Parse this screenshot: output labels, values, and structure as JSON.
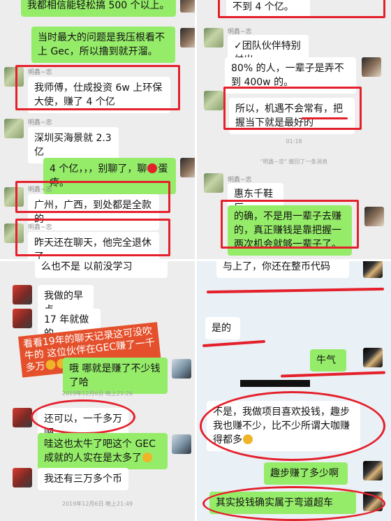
{
  "panel1": {
    "top_partial": "我都相信能轻松搞 500 个以上。",
    "msg1": "当时最大的问题是我压根看不上 Gec，所以撸到就开溜。",
    "sender": "明鑫~忠",
    "msg2": "我师傅，仕成投资 6w 上环保大使，赚了 4 个亿",
    "msg3": "深圳买海景就 2.3 亿",
    "msg4": "4 个亿，，，别聊了，聊",
    "msg4_tail": "蛋疼。",
    "msg5": "广州，广西，到处都是全款的",
    "msg6": "昨天还在聊天，他完全退休了"
  },
  "panel2": {
    "top_partial": "不到 4 个亿。",
    "sender": "明鑫~忠",
    "msg1": "✓团队伙伴特别付出。",
    "msg2": "80% 的人，一辈子是弄不到 400w 的。",
    "msg3": "所以，机遇不会常有，把握当下就是最好的",
    "time": "01:18",
    "recall": "\"明鑫~忠\" 撤回了一条消息",
    "msg4": "惠东千鞋厂",
    "msg5": "的确，不是用一辈子去赚的，真正赚钱是靠把握一两次机会就够一辈子了。"
  },
  "panel3": {
    "top_partial": "么也不是  以前没学习",
    "msg1": "我做的早点",
    "msg2": "17 年就做的",
    "overlay": "看看19年的聊天记录这可没吹牛的 这位伙伴在GEC赚了一千多万",
    "msg3": "哦  哪就是赚了不少钱了哈",
    "time1": "2019年12月6日 晚上21:26",
    "msg4": "还可以，一千多万吧",
    "msg5": "哇这也太牛了吧这个 GEC 成就的人实在是太多了",
    "msg6": "我还有三万多个币",
    "time2": "2019年12月6日 晚上21:49"
  },
  "panel4": {
    "top_partial": "与上了，你还在整币代码",
    "msg1": "是的",
    "msg2": "牛气",
    "msg3": "不是，我做项目喜欢投钱，趣步我也赚不少，比不少所谓大咖赚得都多",
    "msg4": "趣步赚了多少啊",
    "msg5": "其实投钱确实属于弯道超车"
  }
}
